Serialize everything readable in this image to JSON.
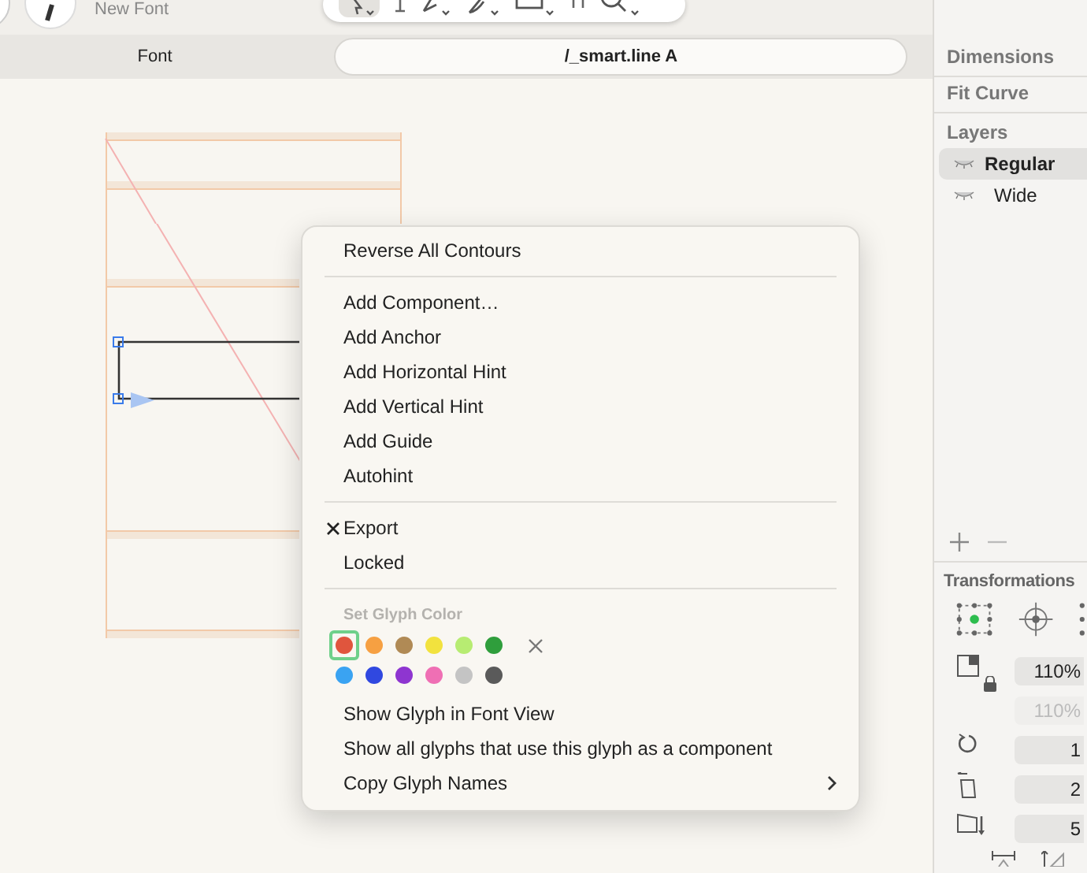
{
  "app": {
    "document_name": "New Font"
  },
  "tabs": [
    {
      "label": "Font",
      "selected": false
    },
    {
      "label": "/_smart.line A",
      "selected": true
    }
  ],
  "sidebar": {
    "sections": [
      {
        "title": "Dimensions"
      },
      {
        "title": "Fit Curve"
      }
    ],
    "layers": {
      "title": "Layers",
      "items": [
        {
          "name": "Regular",
          "selected": true
        },
        {
          "name": "Wide",
          "selected": false
        }
      ]
    },
    "transformations": {
      "title": "Transformations",
      "fields": [
        {
          "value": "110%",
          "disabled": false
        },
        {
          "value": "110%",
          "disabled": true
        },
        {
          "value": "1",
          "disabled": false
        },
        {
          "value": "2",
          "disabled": false
        },
        {
          "value": "5",
          "disabled": false
        }
      ]
    }
  },
  "context_menu": {
    "groups": [
      {
        "kind": "items",
        "items": [
          {
            "label": "Reverse All Contours",
            "checked": false,
            "submenu": false
          }
        ]
      },
      {
        "kind": "items",
        "items": [
          {
            "label": "Add Component…",
            "checked": false,
            "submenu": false
          },
          {
            "label": "Add Anchor",
            "checked": false,
            "submenu": false
          },
          {
            "label": "Add Horizontal Hint",
            "checked": false,
            "submenu": false
          },
          {
            "label": "Add Vertical Hint",
            "checked": false,
            "submenu": false
          },
          {
            "label": "Add Guide",
            "checked": false,
            "submenu": false
          },
          {
            "label": "Autohint",
            "checked": false,
            "submenu": false
          }
        ]
      },
      {
        "kind": "items",
        "items": [
          {
            "label": "Export",
            "checked": true,
            "submenu": false
          },
          {
            "label": "Locked",
            "checked": false,
            "submenu": false
          }
        ]
      },
      {
        "kind": "colors",
        "title": "Set Glyph Color",
        "colors": [
          {
            "color": "#e0553d",
            "selected": true
          },
          {
            "color": "#f6a042",
            "selected": false
          },
          {
            "color": "#b08a55",
            "selected": false
          },
          {
            "color": "#f2e23e",
            "selected": false
          },
          {
            "color": "#b7ec72",
            "selected": false
          },
          {
            "color": "#2f9e3c",
            "selected": false
          },
          {
            "color": "#3aa3f2",
            "selected": false
          },
          {
            "color": "#3048e0",
            "selected": false
          },
          {
            "color": "#8e35d0",
            "selected": false
          },
          {
            "color": "#ef6fb4",
            "selected": false
          },
          {
            "color": "#c4c4c4",
            "selected": false
          },
          {
            "color": "#5a5a5a",
            "selected": false
          }
        ],
        "items": [
          {
            "label": "Show Glyph in Font View",
            "checked": false,
            "submenu": false
          },
          {
            "label": "Show all glyphs that use this glyph as a component",
            "checked": false,
            "submenu": false
          },
          {
            "label": "Copy Glyph Names",
            "checked": false,
            "submenu": true
          }
        ]
      }
    ]
  }
}
